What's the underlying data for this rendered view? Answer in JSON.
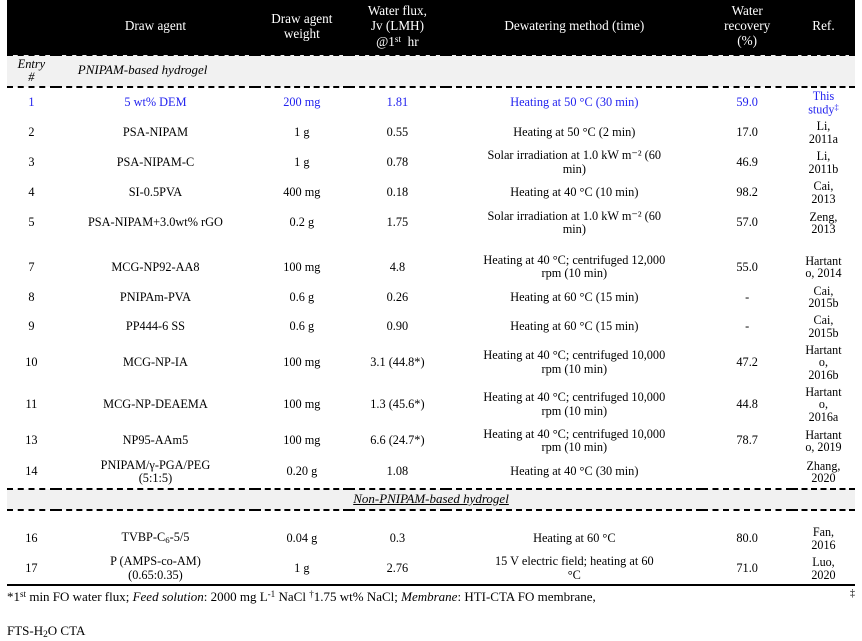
{
  "table": {
    "columns": [
      {
        "key": "entry",
        "label": ""
      },
      {
        "key": "agent",
        "label": "Draw  agent"
      },
      {
        "key": "weight",
        "label_line1": "Draw  agent",
        "label_line2": "weight"
      },
      {
        "key": "flux",
        "label_line1": "Water  flux,",
        "label_line2": "Jv (LMH)",
        "label_line3": "@1st  hr"
      },
      {
        "key": "method",
        "label": "Dewatering  method  (time)"
      },
      {
        "key": "recovery",
        "label_line1": "Water",
        "label_line2": "recovery",
        "label_line3": "(%)"
      },
      {
        "key": "ref",
        "label": "Ref."
      }
    ],
    "entry_header": {
      "line1": "Entry",
      "line2": "#"
    },
    "sections": [
      {
        "label": "PNIPAM-based  hydrogel",
        "align": "left",
        "rows": [
          {
            "entry": "1",
            "agent": "5 wt%  DEM",
            "weight": "200  mg",
            "flux": "1.81",
            "method": "Heating  at  50 °C  (30  min)",
            "recovery": "59.0",
            "ref_line1": "This",
            "ref_line2": "study",
            "ref_sup": "‡",
            "highlight": true
          },
          {
            "entry": "2",
            "agent": "PSA-NIPAM",
            "weight": "1  g",
            "flux": "0.55",
            "method": "Heating  at  50 °C  (2  min)",
            "recovery": "17.0",
            "ref_line1": "Li,",
            "ref_line2": "2011a",
            "highlight": false
          },
          {
            "entry": "3",
            "agent": "PSA-NIPAM-C",
            "weight": "1  g",
            "flux": "0.78",
            "method_line1": "Solar  irradiation  at  1.0  kW  m⁻²  (60",
            "method_line2": "min)",
            "recovery": "46.9",
            "ref_line1": "Li,",
            "ref_line2": "2011b",
            "highlight": false
          },
          {
            "entry": "4",
            "agent": "SI-0.5PVA",
            "weight": "400  mg",
            "flux": "0.18",
            "method": "Heating  at  40 °C  (10  min)",
            "recovery": "98.2",
            "ref_line1": "Cai,",
            "ref_line2": "2013",
            "highlight": false
          },
          {
            "entry": "5",
            "agent": "PSA-NIPAM+3.0wt%  rGO",
            "weight": "0.2  g",
            "flux": "1.75",
            "method_line1": "Solar  irradiation  at  1.0  kW  m⁻²  (60",
            "method_line2": "min)",
            "recovery": "57.0",
            "ref_line1": "Zeng,",
            "ref_line2": "2013",
            "highlight": false
          },
          {
            "blank": true
          },
          {
            "entry": "7",
            "agent": "MCG-NP92-AA8",
            "weight": "100  mg",
            "flux": "4.8",
            "method_line1": "Heating  at  40 °C;  centrifuged  12,000",
            "method_line2": "rpm  (10    min)",
            "recovery": "55.0",
            "ref_line1": "Hartant",
            "ref_line2": "o,  2014",
            "highlight": false
          },
          {
            "entry": "8",
            "agent": "PNIPAm-PVA",
            "weight": "0.6  g",
            "flux": "0.26",
            "method": "Heating  at  60 °C  (15  min)",
            "recovery": "-",
            "ref_line1": "Cai,",
            "ref_line2": "2015b",
            "highlight": false
          },
          {
            "entry": "9",
            "agent": "PP444-6  SS",
            "weight": "0.6  g",
            "flux": "0.90",
            "method": "Heating  at  60 °C  (15  min)",
            "recovery": "-",
            "ref_line1": "Cai,",
            "ref_line2": "2015b",
            "highlight": false
          },
          {
            "entry": "10",
            "agent": "MCG-NP-IA",
            "weight": "100  mg",
            "flux": "3.1  (44.8*)",
            "method_line1": "Heating  at  40 °C;  centrifuged  10,000",
            "method_line2": "rpm  (10  min)",
            "recovery": "47.2",
            "ref_line1": "Hartant",
            "ref_line2": "o,",
            "ref_line3": "2016b",
            "highlight": false
          },
          {
            "entry": "11",
            "agent": "MCG-NP-DEAEMA",
            "weight": "100  mg",
            "flux": "1.3  (45.6*)",
            "method_line1": "Heating  at  40 °C;  centrifuged  10,000",
            "method_line2": "rpm  (10  min)",
            "recovery": "44.8",
            "ref_line1": "Hartant",
            "ref_line2": "o,",
            "ref_line3": "2016a",
            "highlight": false
          },
          {
            "entry": "13",
            "agent": "NP95-AAm5",
            "weight": "100  mg",
            "flux": "6.6  (24.7*)",
            "method_line1": "Heating  at  40 °C;  centrifuged  10,000",
            "method_line2": "rpm  (10  min)",
            "recovery": "78.7",
            "ref_line1": "Hartant",
            "ref_line2": "o,  2019",
            "highlight": false
          },
          {
            "entry": "14",
            "agent_line1": "PNIPAM/γ-PGA/PEG",
            "agent_line2": "(5:1:5)",
            "weight": "0.20  g",
            "flux": "1.08",
            "method": "Heating  at  40 °C  (30  min)",
            "recovery": "",
            "ref_line1": "Zhang,",
            "ref_line2": "2020",
            "highlight": false
          }
        ]
      },
      {
        "label": "Non-PNIPAM-based  hydrogel",
        "align": "center",
        "rows": [
          {
            "blank": true
          },
          {
            "entry": "16",
            "agent": "TVBP-C₆-5/5",
            "agent_sub_base": "TVBP-C",
            "agent_sub": "6",
            "agent_tail": "-5/5",
            "weight": "0.04  g",
            "flux": "0.3",
            "method": "Heating  at  60 °C",
            "recovery": "80.0",
            "ref_line1": "Fan,",
            "ref_line2": "2016",
            "highlight": false
          },
          {
            "entry": "17",
            "agent_line1": "P  (AMPS-co-AM)",
            "agent_line2": "(0.65:0.35)",
            "weight": "1  g",
            "flux": "2.76",
            "method_line1": "15 V  electric  field;  heating  at    60",
            "method_line2": "°C",
            "recovery": "71.0",
            "ref_line1": "Luo,",
            "ref_line2": "2020",
            "highlight": false
          }
        ]
      }
    ]
  },
  "footnote": {
    "star": "*1",
    "star_sup": "st",
    "part1": "  min  FO  water  flux;  ",
    "feed_label": "Feed  solution",
    "part2": ":  2000  mg  L",
    "part2_sup": "-1",
    "part3": "  NaCl  ",
    "dagger": "†",
    "part4": "1.75  wt%  NaCl;  ",
    "membrane_label": "Membrane",
    "part5": ":  HTI-CTA  FO  membrane,  ",
    "end_dagger": "‡",
    "line2": "FTS-H₂O  CTA",
    "line2_base": "FTS-H",
    "line2_sub": "2",
    "line2_tail": "O  CTA"
  },
  "colors": {
    "header_bg": "#000000",
    "header_text": "#ffffff",
    "highlight_text": "#2323ef",
    "section_bg": "#f1f1f1",
    "body_text": "#000000",
    "page_bg": "#ffffff"
  }
}
